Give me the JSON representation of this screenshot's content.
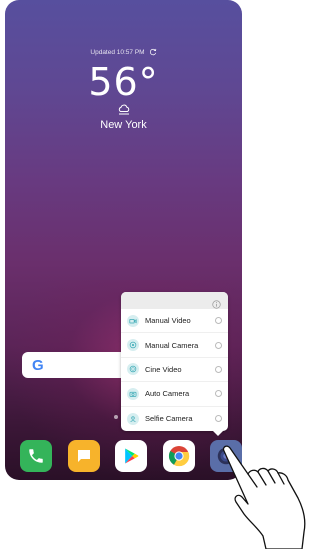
{
  "weather": {
    "updated_text": "Updated 10:57 PM",
    "temperature": "56°",
    "city": "New York"
  },
  "search": {
    "logo_letter": "G"
  },
  "camera_shortcuts": {
    "items": [
      {
        "label": "Manual Video",
        "icon": "video-icon"
      },
      {
        "label": "Manual Camera",
        "icon": "aperture-icon"
      },
      {
        "label": "Cine Video",
        "icon": "film-icon"
      },
      {
        "label": "Auto Camera",
        "icon": "camera-icon"
      },
      {
        "label": "Selfie Camera",
        "icon": "selfie-icon"
      }
    ]
  },
  "dock": {
    "apps": [
      "phone-icon",
      "messages-icon",
      "play-store-icon",
      "chrome-icon",
      "camera-icon"
    ]
  },
  "colors": {
    "accent": "#3aa9b5",
    "phone_app": "#34b45a",
    "messages_app": "#f7b32b",
    "camera_app": "#5a6ea8"
  }
}
